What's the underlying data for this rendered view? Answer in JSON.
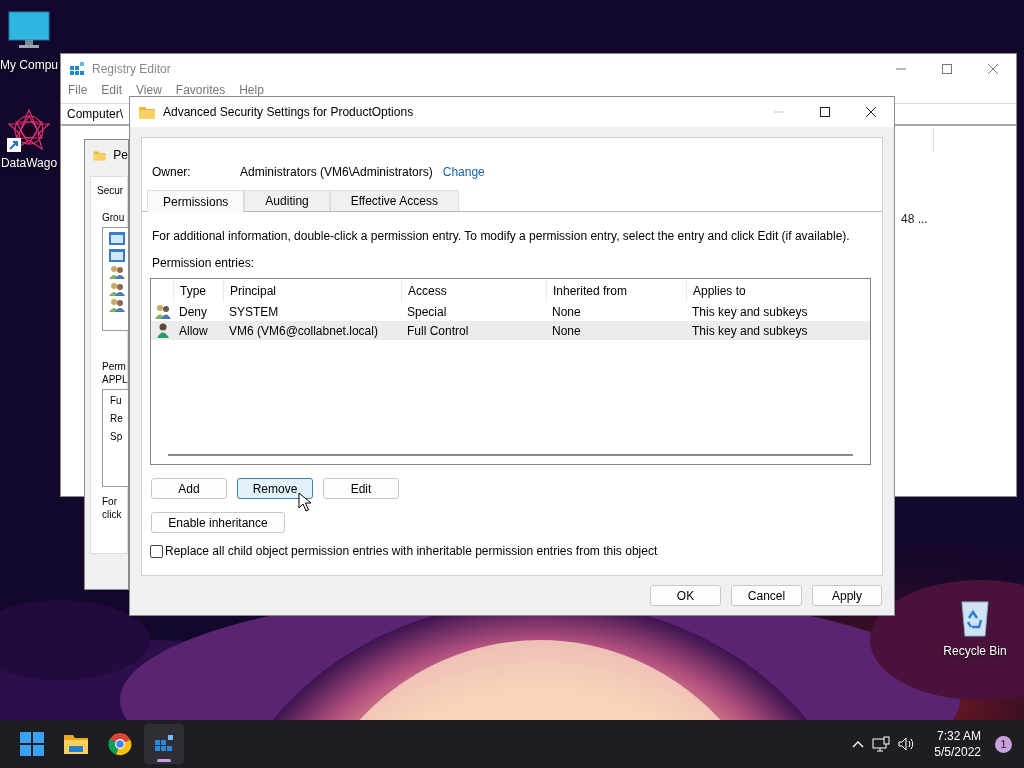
{
  "desktop_icons": [
    {
      "label": "My Compu",
      "kind": "computer",
      "shortcut": false
    },
    {
      "label": "DataWago",
      "kind": "app",
      "shortcut": true
    },
    {
      "label": "Recycle Bin",
      "kind": "recycle",
      "shortcut": false
    }
  ],
  "registry_editor": {
    "title": "Registry Editor",
    "menu": [
      "File",
      "Edit",
      "View",
      "Favorites",
      "Help"
    ],
    "address": "Computer\\",
    "column_text": "48 ..."
  },
  "permissions_dialog": {
    "title": "Pe",
    "tab": "Secur",
    "group_label": "Grou",
    "permissions_label": "Perm",
    "permissions_sublabel": "APPL",
    "permission_items": [
      "Fu",
      "Re",
      "Sp"
    ],
    "note_lines": [
      "For",
      "click"
    ]
  },
  "advanced_dialog": {
    "title": "Advanced Security Settings for ProductOptions",
    "owner_label": "Owner:",
    "owner_value": "Administrators (VM6\\Administrators)",
    "owner_link": "Change",
    "tabs": [
      {
        "label": "Permissions",
        "selected": true
      },
      {
        "label": "Auditing",
        "selected": false
      },
      {
        "label": "Effective Access",
        "selected": false
      }
    ],
    "info": "For additional information, double-click a permission entry. To modify a permission entry, select the entry and click Edit (if available).",
    "entries_label": "Permission entries:",
    "columns": [
      "Type",
      "Principal",
      "Access",
      "Inherited from",
      "Applies to"
    ],
    "rows": [
      {
        "kind": "group",
        "type": "Deny",
        "principal": "SYSTEM",
        "access": "Special",
        "inherited_from": "None",
        "applies_to": "This key and subkeys",
        "selected": false
      },
      {
        "kind": "user",
        "type": "Allow",
        "principal": "VM6 (VM6@collabnet.local)",
        "access": "Full Control",
        "inherited_from": "None",
        "applies_to": "This key and subkeys",
        "selected": true
      }
    ],
    "buttons": [
      {
        "label": "Add",
        "hot": false
      },
      {
        "label": "Remove",
        "hot": true
      },
      {
        "label": "Edit",
        "hot": false
      }
    ],
    "inheritance_button": "Enable inheritance",
    "replace_checkbox": {
      "label": "Replace all child object permission entries with inheritable permission entries from this object",
      "checked": false
    },
    "footer_buttons": [
      "OK",
      "Cancel",
      "Apply"
    ]
  },
  "taskbar": {
    "apps": [
      {
        "kind": "start",
        "running": false
      },
      {
        "kind": "explorer",
        "running": false
      },
      {
        "kind": "browser",
        "running": false
      },
      {
        "kind": "registry",
        "running": true
      }
    ],
    "time": "7:32 AM",
    "date": "5/5/2022",
    "notification_count": "1"
  }
}
